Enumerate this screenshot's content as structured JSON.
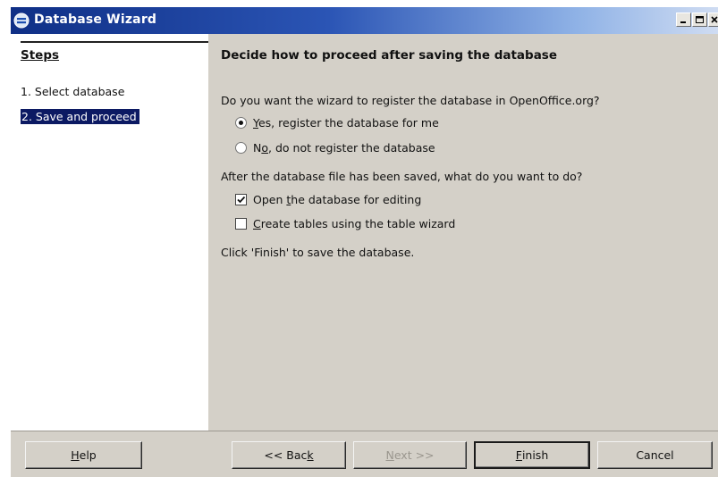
{
  "window": {
    "title": "Database Wizard",
    "icon": "database-wizard-icon",
    "controls": [
      "minimize-icon",
      "maximize-icon",
      "close-icon"
    ]
  },
  "roadmap": {
    "title": "Steps",
    "items": [
      {
        "label": "1. Select database",
        "active": false
      },
      {
        "label": "2. Save and proceed",
        "active": true
      }
    ]
  },
  "main": {
    "heading": "Decide how to proceed after saving the database",
    "register_question": "Do you want the wizard to register the database in OpenOffice.org?",
    "register_options": [
      {
        "label_prefix": "",
        "mnemonic": "Y",
        "label_rest": "es, register the database for me",
        "checked": true
      },
      {
        "label_prefix": "N",
        "mnemonic": "o",
        "label_rest": ", do not register the database",
        "checked": false
      }
    ],
    "after_question": "After the database file has been saved, what do you want to do?",
    "after_options": [
      {
        "label_prefix": "Open ",
        "mnemonic": "t",
        "label_rest": "he database for editing",
        "checked": true
      },
      {
        "label_prefix": "",
        "mnemonic": "C",
        "label_rest": "reate tables using the table wizard",
        "checked": false
      }
    ],
    "hint": "Click 'Finish' to save the database."
  },
  "buttons": {
    "help": {
      "prefix": "",
      "mnemonic": "H",
      "rest": "elp"
    },
    "back": {
      "prefix": "<< Bac",
      "mnemonic": "k",
      "rest": ""
    },
    "next": {
      "prefix": "",
      "mnemonic": "N",
      "rest": "ext >>",
      "disabled": true
    },
    "finish": {
      "prefix": "",
      "mnemonic": "F",
      "rest": "inish"
    },
    "cancel": {
      "label": "Cancel"
    }
  },
  "colors": {
    "titlebar_start": "#0f2f86",
    "titlebar_end": "#cfdcf2",
    "selection": "#0c1a63",
    "dialog_face": "#d4d0c8"
  }
}
